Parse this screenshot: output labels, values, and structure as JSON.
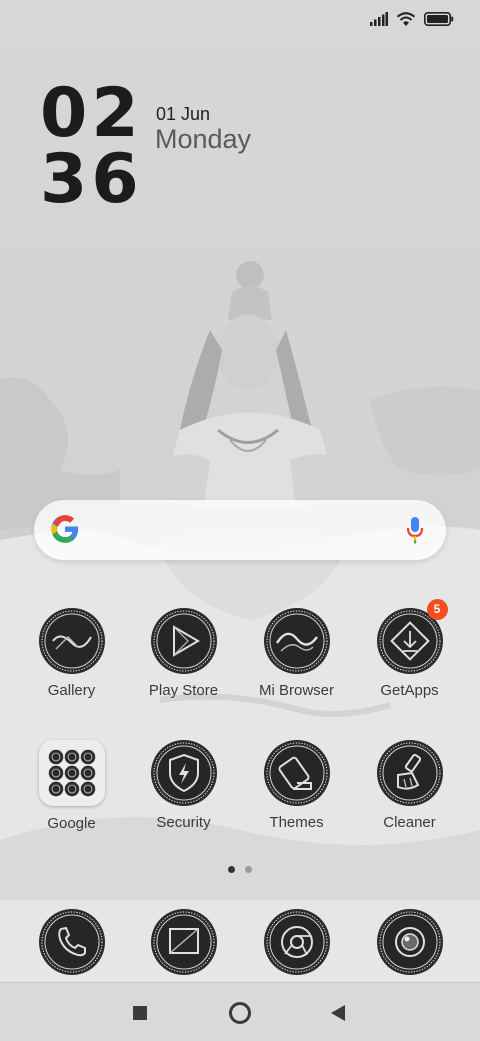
{
  "status": {
    "signal_icon": "signal-icon",
    "wifi_icon": "wifi-icon",
    "battery_icon": "battery-icon"
  },
  "clock": {
    "hours": "02",
    "minutes": "36"
  },
  "date": {
    "date": "01 Jun",
    "day": "Monday"
  },
  "search": {
    "logo_icon": "google-g-icon",
    "mic_icon": "mic-icon"
  },
  "apps_row1": [
    {
      "label": "Gallery",
      "icon": "gallery-icon"
    },
    {
      "label": "Play Store",
      "icon": "play-store-icon"
    },
    {
      "label": "Mi Browser",
      "icon": "browser-icon"
    },
    {
      "label": "GetApps",
      "icon": "getapps-icon",
      "badge": "5"
    }
  ],
  "apps_row2": [
    {
      "label": "Google",
      "icon": "folder-icon"
    },
    {
      "label": "Security",
      "icon": "security-icon"
    },
    {
      "label": "Themes",
      "icon": "themes-icon"
    },
    {
      "label": "Cleaner",
      "icon": "cleaner-icon"
    }
  ],
  "page_indicator": {
    "pages": 2,
    "active": 1
  },
  "dock": [
    {
      "icon": "phone-icon"
    },
    {
      "icon": "messages-icon"
    },
    {
      "icon": "chrome-icon"
    },
    {
      "icon": "camera-icon"
    }
  ],
  "nav": {
    "recents_icon": "recents-icon",
    "home_icon": "home-icon",
    "back_icon": "back-icon"
  },
  "colors": {
    "badge": "#f24e1e",
    "icon_dark": "#2b2b2b",
    "label": "#3b3b3b"
  }
}
